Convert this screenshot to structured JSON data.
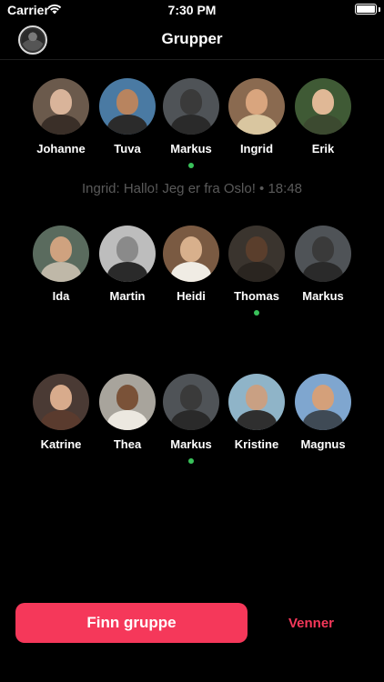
{
  "status_bar": {
    "carrier": "Carrier",
    "time": "7:30 PM"
  },
  "nav": {
    "title": "Grupper"
  },
  "groups": [
    {
      "members": [
        {
          "name": "Johanne",
          "bg": "#6b5a4c",
          "skin": "#d9b49a",
          "shirt": "#3a2f28"
        },
        {
          "name": "Tuva",
          "bg": "#4a7aa3",
          "skin": "#b8845f",
          "shirt": "#2b2b2b"
        },
        {
          "name": "Markus",
          "bg": "#4f5357",
          "skin": "#3a3a3a",
          "shirt": "#2a2a2a"
        },
        {
          "name": "Ingrid",
          "bg": "#8a6a50",
          "skin": "#d9a57e",
          "shirt": "#d9c6a0"
        },
        {
          "name": "Erik",
          "bg": "#3f5a35",
          "skin": "#e0b896",
          "shirt": "#3c4a30"
        }
      ],
      "online_member": "Markus",
      "last_message": "Ingrid: Hallo! Jeg er fra Oslo! • 18:48"
    },
    {
      "members": [
        {
          "name": "Ida",
          "bg": "#5a6b5e",
          "skin": "#cfa27f",
          "shirt": "#bfb8a8"
        },
        {
          "name": "Martin",
          "bg": "#bdbdbd",
          "skin": "#8a8a8a",
          "shirt": "#2a2a2a"
        },
        {
          "name": "Heidi",
          "bg": "#7a5a42",
          "skin": "#d8b08c",
          "shirt": "#f0ece4"
        },
        {
          "name": "Thomas",
          "bg": "#3a342e",
          "skin": "#5a3e2c",
          "shirt": "#2a2520"
        },
        {
          "name": "Markus",
          "bg": "#4f5357",
          "skin": "#3a3a3a",
          "shirt": "#2a2a2a"
        }
      ],
      "online_member": "Thomas"
    },
    {
      "members": [
        {
          "name": "Katrine",
          "bg": "#4a3a34",
          "skin": "#d8ab8c",
          "shirt": "#5a3b2e"
        },
        {
          "name": "Thea",
          "bg": "#a8a49c",
          "skin": "#7a5238",
          "shirt": "#ece8e0"
        },
        {
          "name": "Markus",
          "bg": "#4f5357",
          "skin": "#3a3a3a",
          "shirt": "#2a2a2a"
        },
        {
          "name": "Kristine",
          "bg": "#8fb4c8",
          "skin": "#c9a083",
          "shirt": "#2f2f2f"
        },
        {
          "name": "Magnus",
          "bg": "#7fa6cf",
          "skin": "#d4a07a",
          "shirt": "#3f4a55"
        }
      ],
      "online_member": "Markus"
    }
  ],
  "actions": {
    "primary_label": "Finn gruppe",
    "secondary_label": "Venner"
  },
  "colors": {
    "accent": "#f5385a",
    "online": "#39c15a",
    "muted_text": "#5a5a5a"
  }
}
